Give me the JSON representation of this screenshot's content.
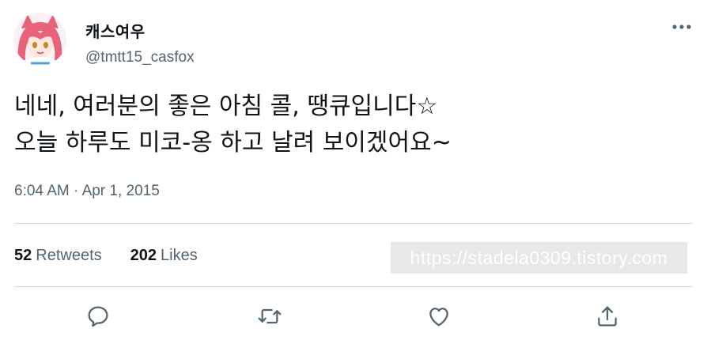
{
  "tweet": {
    "display_name": "캐스여우",
    "handle": "@tmtt15_casfox",
    "text_lines": [
      "네네, 여러분의 좋은 아침 콜, 땡큐입니다☆",
      "오늘 하루도 미코-옹 하고 날려 보이겠어요~"
    ],
    "time": "6:04 AM",
    "separator": "·",
    "date": "Apr 1, 2015"
  },
  "stats": {
    "retweets_count": "52",
    "retweets_label": "Retweets",
    "likes_count": "202",
    "likes_label": "Likes"
  },
  "watermark": "https://stadela0309.tistory.com",
  "actions": [
    "reply-icon",
    "retweet-icon",
    "like-icon",
    "share-icon"
  ],
  "colors": {
    "text": "#0f1419",
    "secondary": "#536471",
    "icon": "#536471",
    "divider": "#cfd9de",
    "avatar_hair": "#e8637a"
  }
}
